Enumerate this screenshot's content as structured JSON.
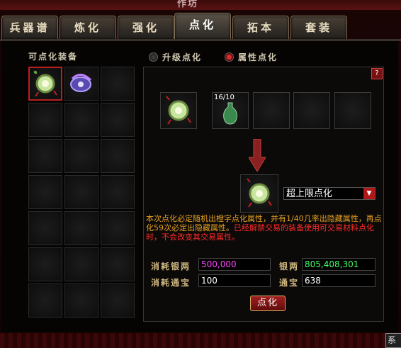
{
  "window": {
    "title": "作坊"
  },
  "tabs": [
    {
      "label": "兵器谱",
      "active": false
    },
    {
      "label": "炼化",
      "active": false
    },
    {
      "label": "强化",
      "active": false
    },
    {
      "label": "点化",
      "active": true
    },
    {
      "label": "拓本",
      "active": false
    },
    {
      "label": "套装",
      "active": false
    }
  ],
  "left": {
    "title": "可点化装备"
  },
  "modes": {
    "upgrade": "升级点化",
    "attribute": "属性点化",
    "selected": "attribute"
  },
  "material": {
    "count": "16/10"
  },
  "select": {
    "value": "超上限点化"
  },
  "description": {
    "part1": "本次点化必定随机出橙字点化属性，并有1/40几率出隐藏属性，再点化59次必定出隐藏属性。",
    "part2": "已经解禁交易的装备使用可交易材料点化时，不会改变其交易属性。"
  },
  "costs": {
    "silver_label": "消耗银两",
    "silver_value": "500,000",
    "coupon_label": "消耗通宝",
    "coupon_value": "100",
    "own_silver_label": "银两",
    "own_silver_value": "805,408,301",
    "own_coupon_label": "通宝",
    "own_coupon_value": "638"
  },
  "buttons": {
    "confirm": "点化",
    "help": "?",
    "system": "系统"
  },
  "colors": {
    "accent_red": "#b01818",
    "magenta": "#ff44ff",
    "green": "#44ff66",
    "orange": "#e8a020"
  }
}
